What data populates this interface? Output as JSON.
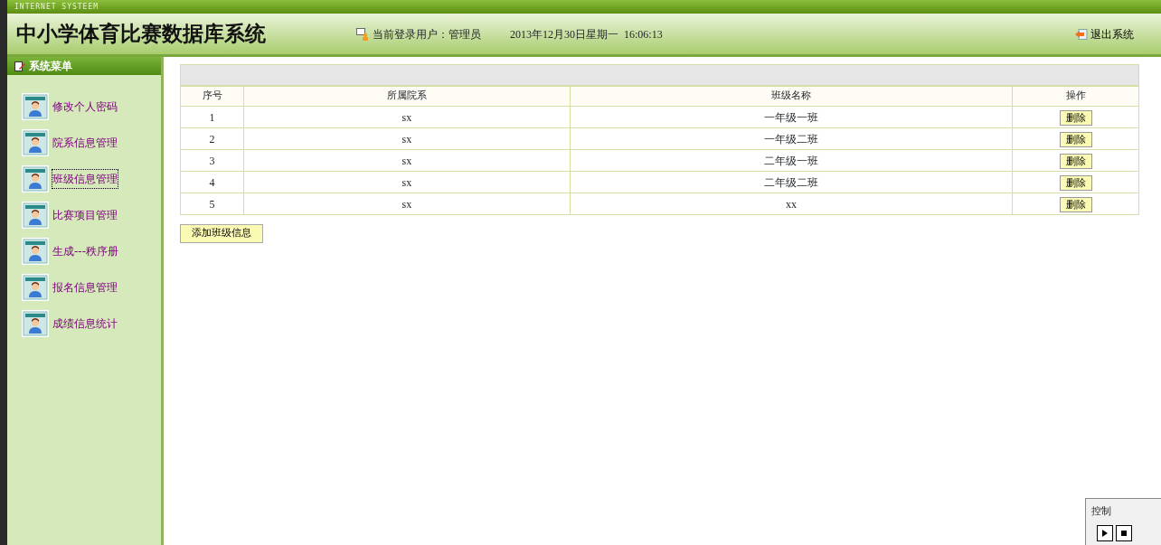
{
  "top_strip": {
    "label": "INTERNET SYSTEEM"
  },
  "header": {
    "title": "中小学体育比赛数据库系统",
    "user_label": "当前登录用户：管理员",
    "datetime": "2013年12月30日星期一  16:06:13",
    "logout": "退出系统"
  },
  "sidebar": {
    "title": "系统菜单",
    "items": [
      {
        "label": "修改个人密码",
        "focused": false
      },
      {
        "label": "院系信息管理",
        "focused": false
      },
      {
        "label": "班级信息管理",
        "focused": true
      },
      {
        "label": "比赛项目管理",
        "focused": false
      },
      {
        "label": "生成---秩序册",
        "focused": false
      },
      {
        "label": "报名信息管理",
        "focused": false
      },
      {
        "label": "成绩信息统计",
        "focused": false
      }
    ]
  },
  "table": {
    "columns": [
      "序号",
      "所属院系",
      "班级名称",
      "操作"
    ],
    "rows": [
      {
        "no": "1",
        "dept": "sx",
        "class_name": "一年级一班",
        "action": "删除"
      },
      {
        "no": "2",
        "dept": "sx",
        "class_name": "一年级二班",
        "action": "删除"
      },
      {
        "no": "3",
        "dept": "sx",
        "class_name": "二年级一班",
        "action": "删除"
      },
      {
        "no": "4",
        "dept": "sx",
        "class_name": "二年级二班",
        "action": "删除"
      },
      {
        "no": "5",
        "dept": "sx",
        "class_name": "xx",
        "action": "删除"
      }
    ]
  },
  "add_button": "添加班级信息",
  "control_panel": {
    "title": "控制"
  }
}
